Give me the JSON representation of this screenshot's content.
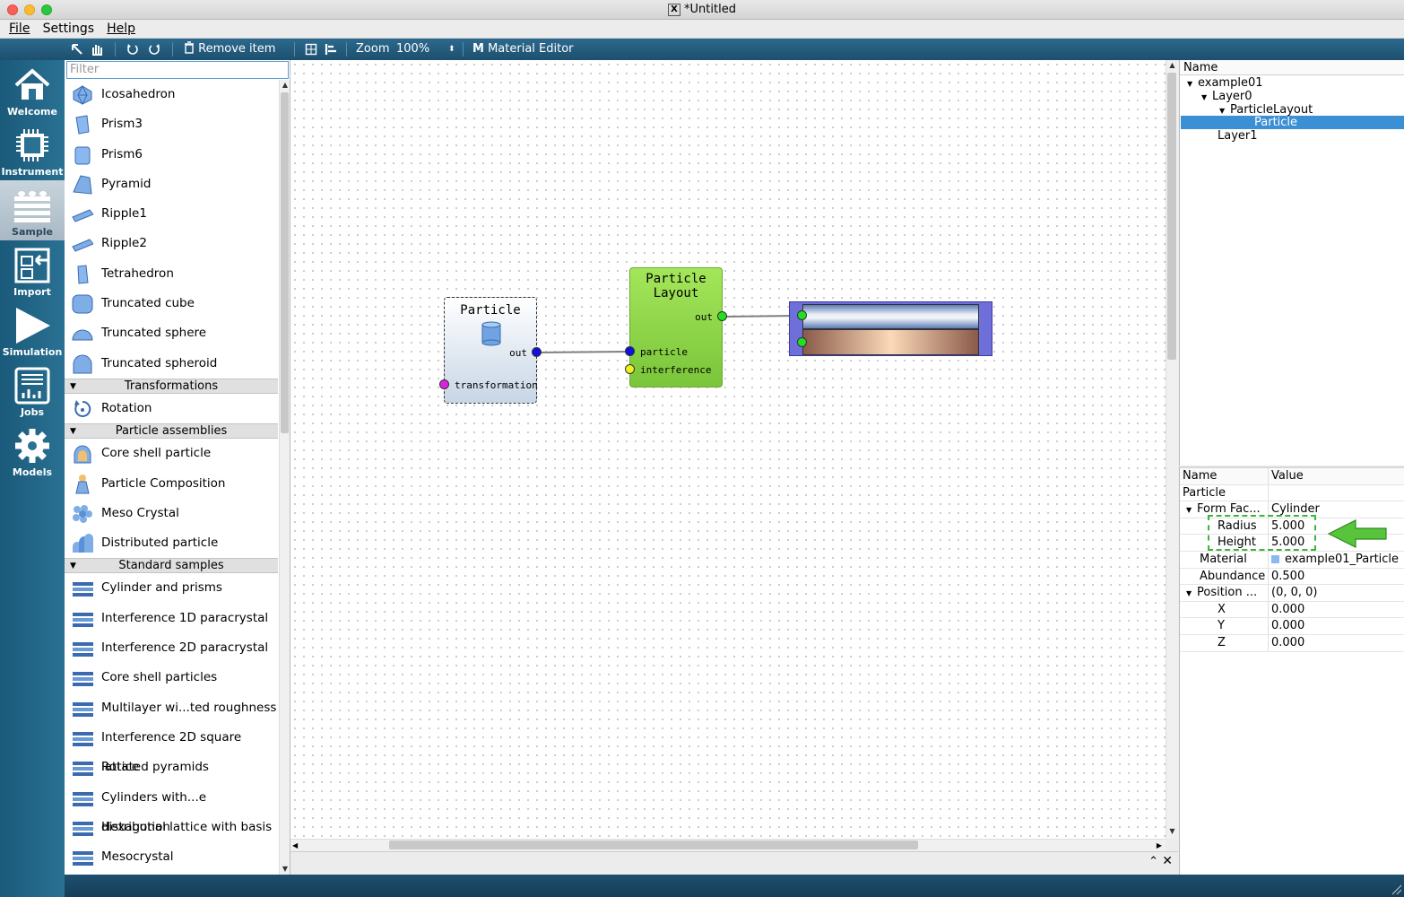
{
  "window": {
    "title": "*Untitled"
  },
  "menu": {
    "file": "File",
    "settings": "Settings",
    "help": "Help"
  },
  "toolbar": {
    "remove_item": "Remove item",
    "zoom_label": "Zoom",
    "zoom_value": "100%",
    "material_editor": "Material Editor"
  },
  "dock": [
    {
      "label": "Welcome",
      "icon": "home-icon"
    },
    {
      "label": "Instrument",
      "icon": "chip-icon"
    },
    {
      "label": "Sample",
      "icon": "layers-icon",
      "active": true
    },
    {
      "label": "Import",
      "icon": "import-icon"
    },
    {
      "label": "Simulation",
      "icon": "play-icon"
    },
    {
      "label": "Jobs",
      "icon": "jobs-icon"
    },
    {
      "label": "Models",
      "icon": "gear-icon"
    }
  ],
  "palette": {
    "filter_placeholder": "Filter",
    "shapes": [
      "Icosahedron",
      "Prism3",
      "Prism6",
      "Pyramid",
      "Ripple1",
      "Ripple2",
      "Tetrahedron",
      "Truncated cube",
      "Truncated sphere",
      "Truncated spheroid"
    ],
    "groups": {
      "transformations": "Transformations",
      "assemblies": "Particle assemblies",
      "standard": "Standard samples"
    },
    "transformations": [
      "Rotation"
    ],
    "assemblies": [
      "Core shell particle",
      "Particle Composition",
      "Meso Crystal",
      "Distributed particle"
    ],
    "standard": [
      "Cylinder and prisms",
      "Interference 1D paracrystal",
      "Interference 2D paracrystal",
      "Core shell particles",
      "Multilayer wi...ted roughness",
      "Interference 2D square lattice",
      "Rotated pyramids",
      "Cylinders with...e distribution",
      "Hexagonal lattice with basis",
      "Mesocrystal"
    ]
  },
  "canvas": {
    "particle_node": {
      "title": "Particle",
      "out": "out",
      "transformation": "transformation"
    },
    "layout_node": {
      "title_line1": "Particle",
      "title_line2": "Layout",
      "out": "out",
      "particle": "particle",
      "interference": "interference"
    }
  },
  "tree": {
    "header": "Name",
    "items": [
      "example01",
      "Layer0",
      "ParticleLayout",
      "Particle",
      "Layer1"
    ]
  },
  "properties": {
    "header_name": "Name",
    "header_value": "Value",
    "rows": [
      {
        "name": "Particle",
        "value": ""
      },
      {
        "name": "Form Fac...",
        "value": "Cylinder"
      },
      {
        "name": "Radius",
        "value": "5.000"
      },
      {
        "name": "Height",
        "value": "5.000"
      },
      {
        "name": "Material",
        "value": "example01_Particle"
      },
      {
        "name": "Abundance",
        "value": "0.500"
      },
      {
        "name": "Position ...",
        "value": "(0, 0, 0)"
      },
      {
        "name": "X",
        "value": "0.000"
      },
      {
        "name": "Y",
        "value": "0.000"
      },
      {
        "name": "Z",
        "value": "0.000"
      }
    ]
  },
  "colors": {
    "accent": "#3b8fd4",
    "dock": "#1a5a7a",
    "layout_node": "#8fd64a",
    "highlight": "#3cb43c"
  }
}
